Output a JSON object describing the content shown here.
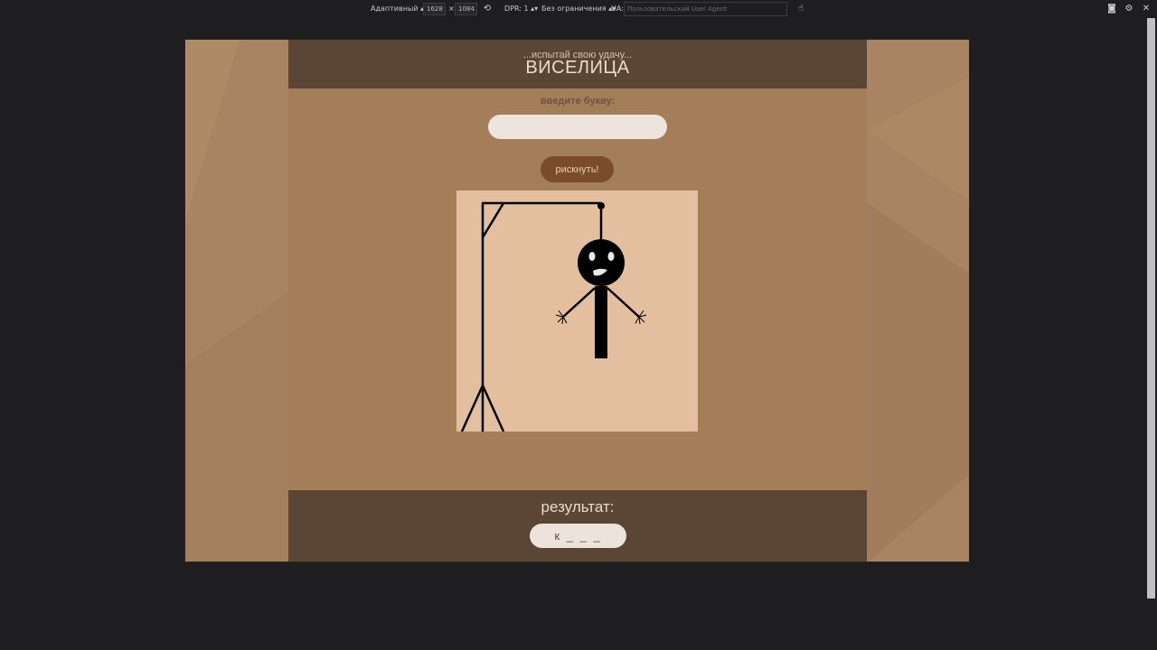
{
  "devtools": {
    "device_mode": "Адаптивный",
    "width": "1628",
    "height_sep": "×",
    "height": "1084",
    "dpr": "DPR: 1",
    "throttle": "Без ограничения",
    "ua_label": "UA:",
    "ua_placeholder": "Пользовательский User Agent"
  },
  "app": {
    "subtitle": "...испытай свою удачу...",
    "title": "ВИСЕЛИЦА",
    "prompt": "введите букву:",
    "input_value": "",
    "risk_button": "рискнуть!",
    "result_label": "результат:",
    "word_display": "к _ _ _"
  },
  "colors": {
    "page_bg": "#a98463",
    "header_bg": "#5b4534",
    "main_bg": "#a47d59",
    "button_bg": "#7a4c29",
    "canvas_bg": "#e4bf9f"
  }
}
